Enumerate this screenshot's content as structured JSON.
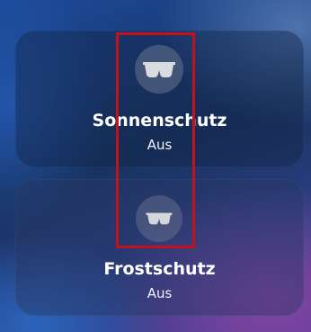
{
  "tiles": [
    {
      "title": "Sonnenschutz",
      "status": "Aus",
      "icon": "sunglasses-icon"
    },
    {
      "title": "Frostschutz",
      "status": "Aus",
      "icon": "sunglasses-icon"
    }
  ],
  "colors": {
    "highlight": "#c4111a",
    "text": "#ffffff",
    "icon": "#d9dbe0"
  }
}
